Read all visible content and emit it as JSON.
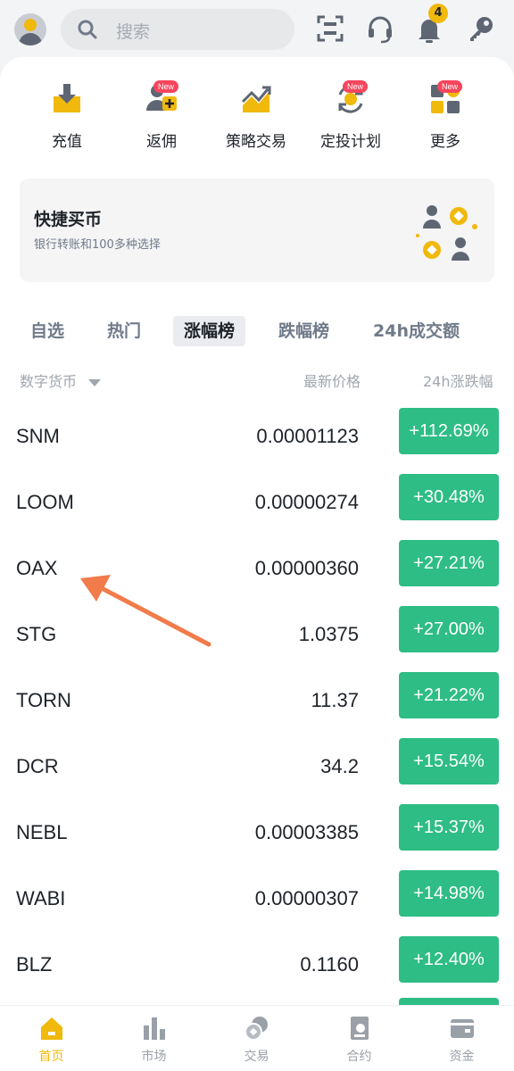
{
  "search": {
    "placeholder": "搜索"
  },
  "notifications": {
    "count": "4"
  },
  "shortcuts": [
    {
      "label": "充值",
      "icon": "deposit-icon",
      "new": false
    },
    {
      "label": "返佣",
      "icon": "referral-icon",
      "new": true
    },
    {
      "label": "策略交易",
      "icon": "strategy-trading-icon",
      "new": false
    },
    {
      "label": "定投计划",
      "icon": "auto-invest-icon",
      "new": true
    },
    {
      "label": "更多",
      "icon": "more-icon",
      "new": true
    }
  ],
  "new_tag": "New",
  "banner": {
    "title": "快捷买币",
    "subtitle": "银行转账和100多种选择"
  },
  "tabs": [
    {
      "label": "自选",
      "active": false
    },
    {
      "label": "热门",
      "active": false
    },
    {
      "label": "涨幅榜",
      "active": true
    },
    {
      "label": "跌幅榜",
      "active": false
    },
    {
      "label": "24h成交额",
      "active": false
    }
  ],
  "columns": {
    "coin": "数字货币",
    "price": "最新价格",
    "change": "24h涨跌幅"
  },
  "rows": [
    {
      "symbol": "SNM",
      "price": "0.00001123",
      "change": "+112.69%"
    },
    {
      "symbol": "LOOM",
      "price": "0.00000274",
      "change": "+30.48%"
    },
    {
      "symbol": "OAX",
      "price": "0.00000360",
      "change": "+27.21%"
    },
    {
      "symbol": "STG",
      "price": "1.0375",
      "change": "+27.00%"
    },
    {
      "symbol": "TORN",
      "price": "11.37",
      "change": "+21.22%"
    },
    {
      "symbol": "DCR",
      "price": "34.2",
      "change": "+15.54%"
    },
    {
      "symbol": "NEBL",
      "price": "0.00003385",
      "change": "+15.37%"
    },
    {
      "symbol": "WABI",
      "price": "0.00000307",
      "change": "+14.98%"
    },
    {
      "symbol": "BLZ",
      "price": "0.1160",
      "change": "+12.40%"
    }
  ],
  "nav": [
    {
      "label": "首页",
      "icon": "home-icon",
      "active": true
    },
    {
      "label": "市场",
      "icon": "market-icon",
      "active": false
    },
    {
      "label": "交易",
      "icon": "trade-icon",
      "active": false
    },
    {
      "label": "合约",
      "icon": "futures-icon",
      "active": false
    },
    {
      "label": "资金",
      "icon": "wallet-icon",
      "active": false
    }
  ],
  "colors": {
    "accent": "#f0b90b",
    "up": "#2ebd85",
    "annotation": "#f27b4b",
    "new_badge": "#f6465d"
  }
}
